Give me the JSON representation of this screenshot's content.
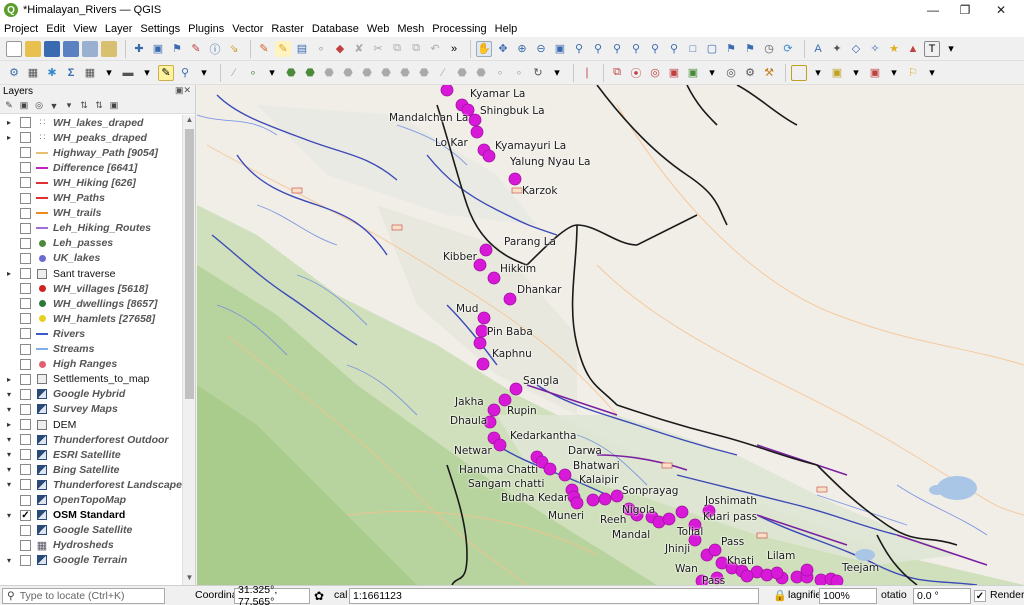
{
  "window": {
    "title": "*Himalayan_Rivers — QGIS",
    "app_icon": "Q"
  },
  "menu": [
    "Project",
    "Edit",
    "View",
    "Layer",
    "Settings",
    "Plugins",
    "Vector",
    "Raster",
    "Database",
    "Web",
    "Mesh",
    "Processing",
    "Help"
  ],
  "layers_panel": {
    "title": "Layers",
    "items": [
      {
        "name": "WH_lakes_draped",
        "style": "it",
        "checked": false,
        "expand": "▸",
        "symbol": "dots"
      },
      {
        "name": "WH_peaks_draped",
        "style": "it",
        "checked": false,
        "expand": "▸",
        "symbol": "dots"
      },
      {
        "name": "Highway_Path [9054]",
        "style": "it",
        "checked": false,
        "expand": "",
        "symbol": "line",
        "color": "#e8c070"
      },
      {
        "name": "Difference [6641]",
        "style": "it",
        "checked": false,
        "expand": "",
        "symbol": "line",
        "color": "#c020c0"
      },
      {
        "name": "WH_Hiking [626]",
        "style": "it",
        "checked": false,
        "expand": "",
        "symbol": "line",
        "color": "#e03030"
      },
      {
        "name": "WH_Paths",
        "style": "it",
        "checked": false,
        "expand": "",
        "symbol": "line",
        "color": "#e03030"
      },
      {
        "name": "WH_trails",
        "style": "it",
        "checked": false,
        "expand": "",
        "symbol": "line",
        "color": "#f08a20"
      },
      {
        "name": "Leh_Hiking_Routes",
        "style": "it",
        "checked": false,
        "expand": "",
        "symbol": "line",
        "color": "#a070d0"
      },
      {
        "name": "Leh_passes",
        "style": "it",
        "checked": false,
        "expand": "",
        "symbol": "dot",
        "color": "#4a8a3a"
      },
      {
        "name": "UK_lakes",
        "style": "it",
        "checked": false,
        "expand": "",
        "symbol": "dot",
        "color": "#6a6ad0"
      },
      {
        "name": "Sant traverse",
        "style": "plain",
        "checked": false,
        "expand": "▸",
        "symbol": "group"
      },
      {
        "name": "WH_villages [5618]",
        "style": "it",
        "checked": false,
        "expand": "",
        "symbol": "dot",
        "color": "#d02020"
      },
      {
        "name": "WH_dwellings [8657]",
        "style": "it",
        "checked": false,
        "expand": "",
        "symbol": "dot",
        "color": "#2a7a3a"
      },
      {
        "name": "WH_hamlets [27658]",
        "style": "it",
        "checked": false,
        "expand": "",
        "symbol": "dot",
        "color": "#e8d020"
      },
      {
        "name": "Rivers",
        "style": "it",
        "checked": false,
        "expand": "",
        "symbol": "line",
        "color": "#3a5ad0"
      },
      {
        "name": "Streams",
        "style": "it",
        "checked": false,
        "expand": "",
        "symbol": "line",
        "color": "#80b0e8"
      },
      {
        "name": "High Ranges",
        "style": "it",
        "checked": false,
        "expand": "",
        "symbol": "dot",
        "color": "#e06070"
      },
      {
        "name": "Settlements_to_map",
        "style": "plain",
        "checked": false,
        "expand": "▸",
        "symbol": "group"
      },
      {
        "name": "Google Hybrid",
        "style": "it",
        "checked": false,
        "expand": "▾",
        "symbol": "raster"
      },
      {
        "name": "Survey Maps",
        "style": "it",
        "checked": false,
        "expand": "▾",
        "symbol": "raster"
      },
      {
        "name": "DEM",
        "style": "plain",
        "checked": false,
        "expand": "▸",
        "symbol": "group"
      },
      {
        "name": "Thunderforest Outdoor",
        "style": "it",
        "checked": false,
        "expand": "▾",
        "symbol": "raster"
      },
      {
        "name": "ESRI Satellite",
        "style": "it",
        "checked": false,
        "expand": "▾",
        "symbol": "raster"
      },
      {
        "name": "Bing Satellite",
        "style": "it",
        "checked": false,
        "expand": "▾",
        "symbol": "raster"
      },
      {
        "name": "Thunderforest Landscape",
        "style": "it",
        "checked": false,
        "expand": "▾",
        "symbol": "raster"
      },
      {
        "name": "OpenTopoMap",
        "style": "it",
        "checked": false,
        "expand": "",
        "symbol": "raster"
      },
      {
        "name": "OSM Standard",
        "style": "bold",
        "checked": true,
        "expand": "▾",
        "symbol": "raster"
      },
      {
        "name": "Google Satellite",
        "style": "it",
        "checked": false,
        "expand": "",
        "symbol": "raster"
      },
      {
        "name": "Hydrosheds",
        "style": "it",
        "checked": false,
        "expand": "",
        "symbol": "grid"
      },
      {
        "name": "Google Terrain",
        "style": "it",
        "checked": false,
        "expand": "▾",
        "symbol": "raster"
      }
    ]
  },
  "map": {
    "labels": [
      "Kyamar La",
      "Shingbuk La",
      "Mandalchan La",
      "Lo Kar",
      "Kyamayuri La",
      "Yalung Nyau La",
      "Karzok",
      "Parang La",
      "Kibber",
      "Hikkim",
      "Dhankar",
      "Mud",
      "Pin Baba",
      "Kaphnu",
      "Sangla",
      "Jakha",
      "Rupin",
      "Dhaula",
      "Kedarkantha",
      "Netwar",
      "Darwa",
      "Hanuma Chatti",
      "Bhatwari",
      "Sangam chatti",
      "Kalaipir",
      "Budha Kedar",
      "Sonprayag",
      "Joshimath",
      "Muneri",
      "Reeh",
      "Nigola",
      "Kuari pass",
      "Mandal",
      "Tolial",
      "Jhinji",
      "Pass",
      "Khati",
      "Lilam",
      "Wan",
      "Pass",
      "Teejam"
    ],
    "marker_color": "#d81ad8"
  },
  "status": {
    "locate_placeholder": "Type to locate (Ctrl+K)",
    "coordinate_label": "Coordinat",
    "coordinate_value": "31.325°, 77.565°",
    "scale_label": "cal",
    "scale_value": "1:1661123",
    "magnifier_label": "lagnifie",
    "magnifier_value": "100%",
    "rotation_label": "otatio",
    "rotation_value": "0.0 °",
    "render_label": "Render"
  }
}
